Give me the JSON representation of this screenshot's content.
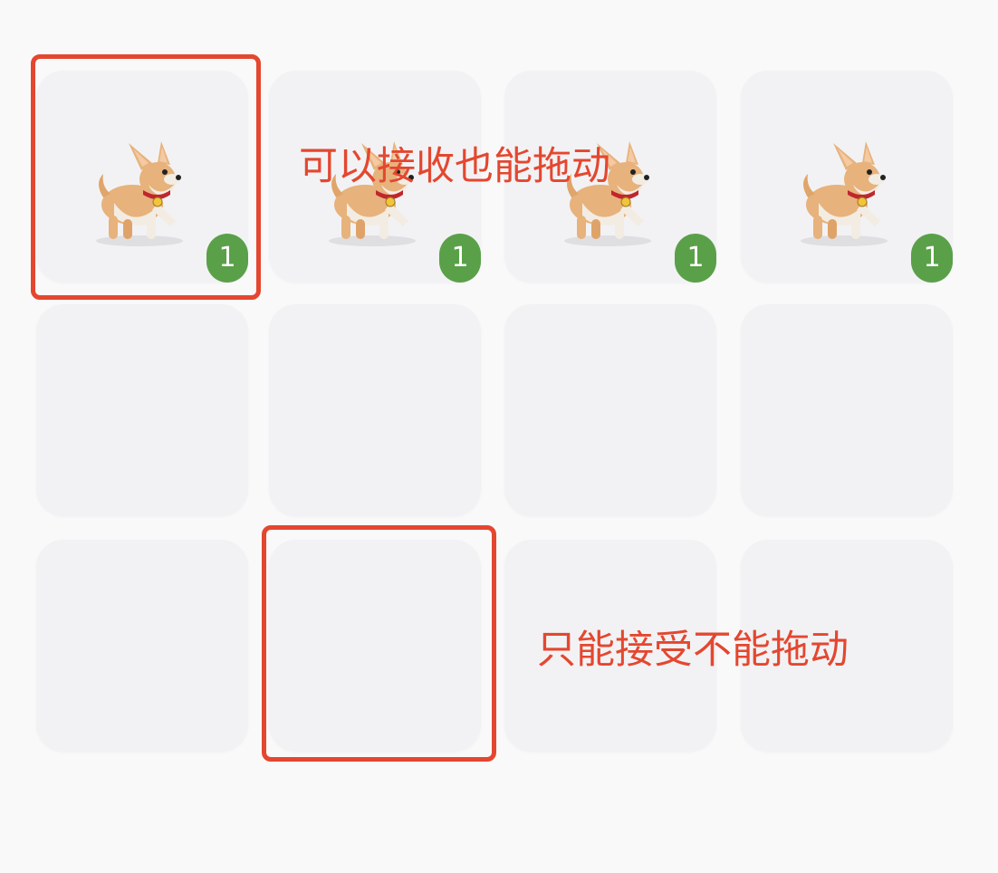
{
  "grid": {
    "rows": 3,
    "columns": 4,
    "slots": [
      {
        "row": 0,
        "col": 0,
        "filled": true,
        "pet": "chihuahua-dog",
        "count": "1"
      },
      {
        "row": 0,
        "col": 1,
        "filled": true,
        "pet": "chihuahua-dog",
        "count": "1"
      },
      {
        "row": 0,
        "col": 2,
        "filled": true,
        "pet": "chihuahua-dog",
        "count": "1"
      },
      {
        "row": 0,
        "col": 3,
        "filled": true,
        "pet": "chihuahua-dog",
        "count": "1"
      },
      {
        "row": 1,
        "col": 0,
        "filled": false
      },
      {
        "row": 1,
        "col": 1,
        "filled": false
      },
      {
        "row": 1,
        "col": 2,
        "filled": false
      },
      {
        "row": 1,
        "col": 3,
        "filled": false
      },
      {
        "row": 2,
        "col": 0,
        "filled": false
      },
      {
        "row": 2,
        "col": 1,
        "filled": false
      },
      {
        "row": 2,
        "col": 2,
        "filled": false
      },
      {
        "row": 2,
        "col": 3,
        "filled": false
      }
    ]
  },
  "annotations": {
    "draggable_text": "可以接收也能拖动",
    "receive_only_text": "只能接受不能拖动"
  },
  "colors": {
    "highlight": "#e4472f",
    "badge": "#5aa049",
    "slot_bg": "#f2f2f4",
    "page_bg": "#f9f9fa"
  }
}
